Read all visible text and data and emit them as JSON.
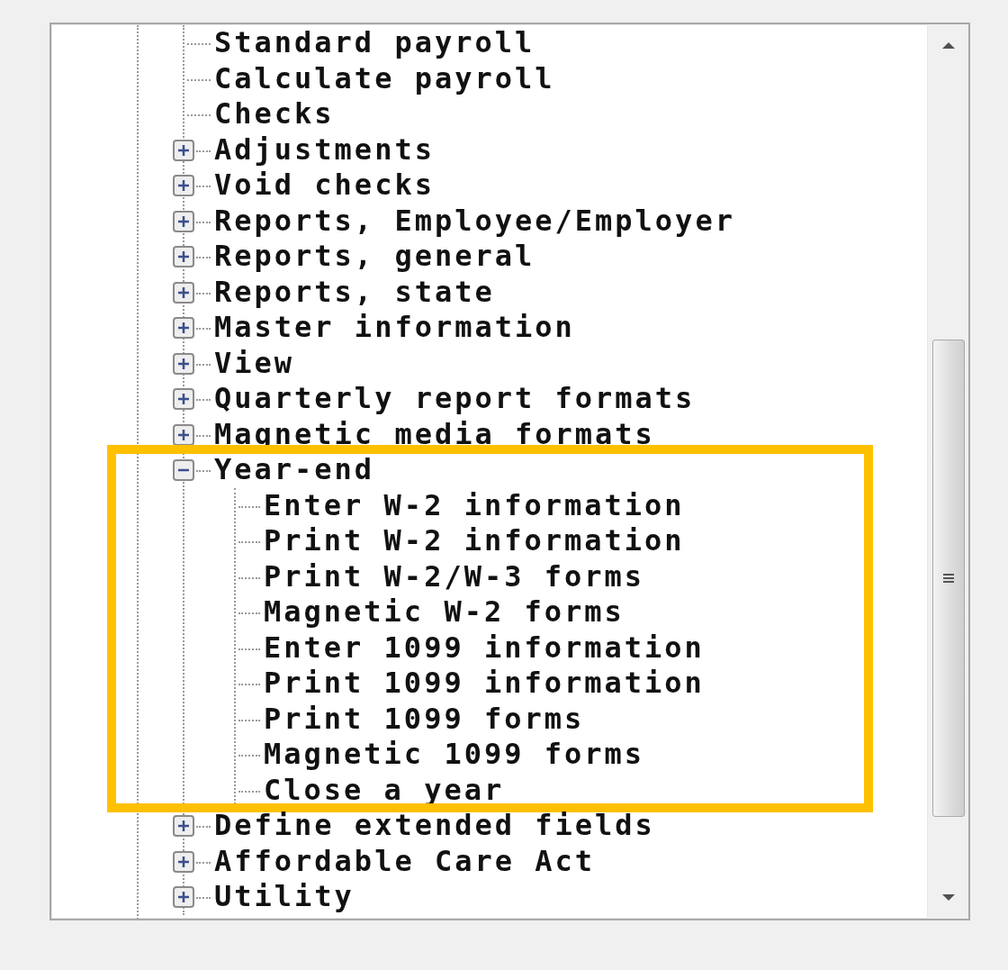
{
  "tree": {
    "items": [
      {
        "label": "Standard payroll",
        "kind": "leaf",
        "highlighted": false
      },
      {
        "label": "Calculate payroll",
        "kind": "leaf",
        "highlighted": false
      },
      {
        "label": "Checks",
        "kind": "leaf",
        "highlighted": false
      },
      {
        "label": "Adjustments",
        "kind": "folder",
        "expanded": false,
        "highlighted": false
      },
      {
        "label": "Void checks",
        "kind": "folder",
        "expanded": false,
        "highlighted": false
      },
      {
        "label": "Reports, Employee/Employer",
        "kind": "folder",
        "expanded": false,
        "highlighted": false
      },
      {
        "label": "Reports, general",
        "kind": "folder",
        "expanded": false,
        "highlighted": false
      },
      {
        "label": "Reports, state",
        "kind": "folder",
        "expanded": false,
        "highlighted": false
      },
      {
        "label": "Master information",
        "kind": "folder",
        "expanded": false,
        "highlighted": false
      },
      {
        "label": "View",
        "kind": "folder",
        "expanded": false,
        "highlighted": false
      },
      {
        "label": "Quarterly report formats",
        "kind": "folder",
        "expanded": false,
        "highlighted": false
      },
      {
        "label": "Magnetic media formats",
        "kind": "folder",
        "expanded": false,
        "highlighted": false
      },
      {
        "label": "Year-end",
        "kind": "folder",
        "expanded": true,
        "highlighted": true,
        "children": [
          {
            "label": "Enter W-2 information",
            "kind": "leaf"
          },
          {
            "label": "Print W-2 information",
            "kind": "leaf"
          },
          {
            "label": "Print W-2/W-3 forms",
            "kind": "leaf"
          },
          {
            "label": "Magnetic W-2 forms",
            "kind": "leaf"
          },
          {
            "label": "Enter 1099 information",
            "kind": "leaf"
          },
          {
            "label": "Print 1099 information",
            "kind": "leaf"
          },
          {
            "label": "Print 1099 forms",
            "kind": "leaf"
          },
          {
            "label": "Magnetic 1099 forms",
            "kind": "leaf"
          },
          {
            "label": "Close a year",
            "kind": "leaf"
          }
        ]
      },
      {
        "label": "Define extended fields",
        "kind": "folder",
        "expanded": false,
        "highlighted": false
      },
      {
        "label": "Affordable Care Act",
        "kind": "folder",
        "expanded": false,
        "highlighted": false
      },
      {
        "label": "Utility",
        "kind": "folder",
        "expanded": false,
        "highlighted": false
      }
    ]
  }
}
